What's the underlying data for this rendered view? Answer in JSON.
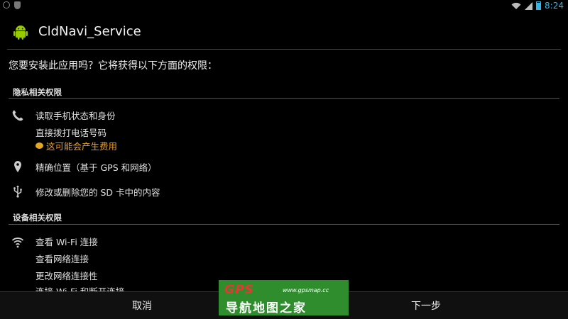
{
  "status_bar": {
    "time": "8:24",
    "left_icons": [
      "notification-dot-icon",
      "shield-icon"
    ],
    "right_icons": [
      "wifi-icon",
      "signal-icon",
      "battery-icon"
    ]
  },
  "app": {
    "title": "CldNavi_Service",
    "icon": "android-icon"
  },
  "question": "您要安装此应用吗？它将获得以下方面的权限：",
  "sections": [
    {
      "title": "隐私相关权限",
      "groups": [
        {
          "icon": "phone-icon",
          "items": [
            "读取手机状态和身份",
            "直接拨打电话号码"
          ],
          "warning": "这可能会产生费用"
        },
        {
          "icon": "location-pin-icon",
          "items": [
            "精确位置（基于 GPS 和网络）"
          ]
        },
        {
          "icon": "usb-icon",
          "items": [
            "修改或删除您的 SD 卡中的内容"
          ]
        }
      ]
    },
    {
      "title": "设备相关权限",
      "groups": [
        {
          "icon": "wifi-icon",
          "items": [
            "查看 Wi-Fi 连接",
            "查看网络连接",
            "更改网络连接性",
            "连接 Wi-Fi 和断开连接"
          ]
        }
      ]
    }
  ],
  "buttons": {
    "cancel": "取消",
    "next": "下一步"
  },
  "watermark": {
    "brand": "GPS",
    "url": "www.gpsmap.cc",
    "name": "导航地图之家"
  },
  "colors": {
    "accent": "#33b5e5",
    "warning": "#f0a020",
    "watermark_bg": "#2f8d2e"
  }
}
